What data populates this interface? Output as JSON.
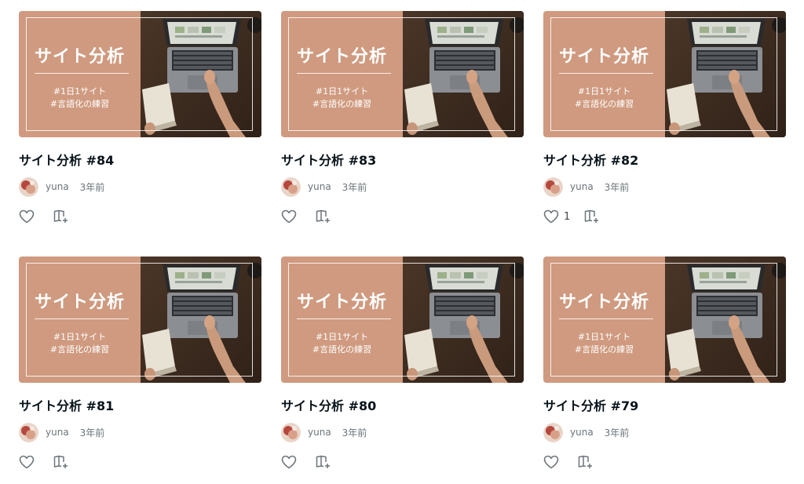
{
  "thumbnail": {
    "title": "サイト分析",
    "tag1": "#1日1サイト",
    "tag2": "#言語化の練習"
  },
  "colors": {
    "thumbnail_panel": "#cf9a7f",
    "text": "#08131a",
    "muted": "#6b747a"
  },
  "notes": [
    {
      "title": "サイト分析 #84",
      "author": "yuna",
      "time": "3年前",
      "likes": ""
    },
    {
      "title": "サイト分析 #83",
      "author": "yuna",
      "time": "3年前",
      "likes": ""
    },
    {
      "title": "サイト分析 #82",
      "author": "yuna",
      "time": "3年前",
      "likes": "1"
    },
    {
      "title": "サイト分析 #81",
      "author": "yuna",
      "time": "3年前",
      "likes": ""
    },
    {
      "title": "サイト分析 #80",
      "author": "yuna",
      "time": "3年前",
      "likes": ""
    },
    {
      "title": "サイト分析 #79",
      "author": "yuna",
      "time": "3年前",
      "likes": ""
    }
  ],
  "icons": {
    "like": "heart-icon",
    "save": "magazine-add-icon"
  }
}
